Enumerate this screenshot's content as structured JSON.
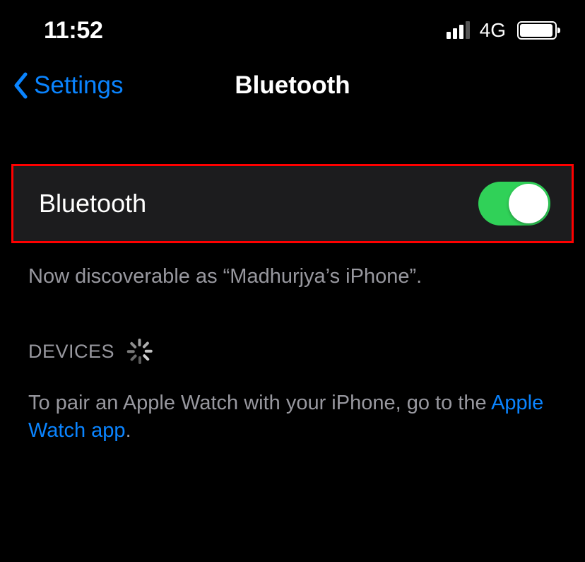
{
  "statusbar": {
    "time": "11:52",
    "network": "4G"
  },
  "nav": {
    "back_label": "Settings",
    "title": "Bluetooth"
  },
  "main": {
    "bluetooth_label": "Bluetooth",
    "toggle_on": true,
    "discoverable_text": "Now discoverable as “Madhurjya’s iPhone”."
  },
  "devices": {
    "header_label": "DEVICES",
    "pairing_text_prefix": "To pair an Apple Watch with your iPhone, go to the ",
    "pairing_link": "Apple Watch app",
    "pairing_text_suffix": "."
  },
  "colors": {
    "accent": "#0a84ff",
    "toggle_on": "#30d158",
    "highlight_border": "#ff0000",
    "text_secondary": "#98989f"
  }
}
